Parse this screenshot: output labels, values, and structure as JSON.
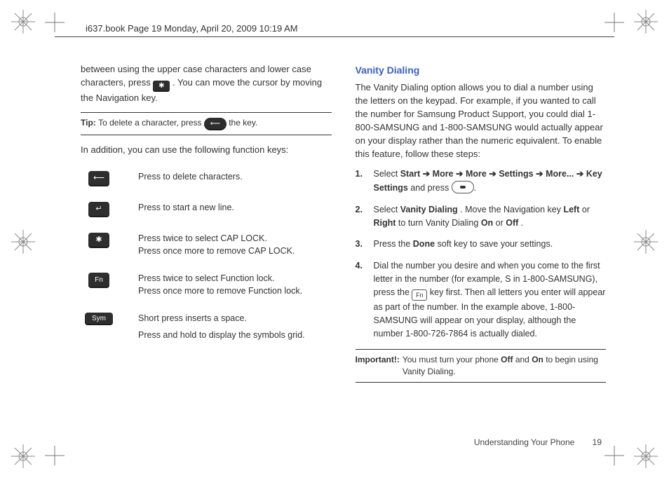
{
  "header": {
    "text": "i637.book  Page 19  Monday, April 20, 2009  10:19 AM"
  },
  "left": {
    "intro_a": "between using the upper case characters and lower case characters, press ",
    "intro_b": ". You can move the cursor by moving the Navigation key.",
    "tip_lead": "Tip: ",
    "tip_a": "To delete a character, press ",
    "tip_b": " the key.",
    "addition": "In addition, you can use the following function keys:",
    "rows": [
      {
        "desc": "Press to delete characters."
      },
      {
        "desc": "Press to start a new line."
      },
      {
        "desc1": "Press twice to select CAP LOCK.",
        "desc2": "Press once more to remove CAP LOCK."
      },
      {
        "desc1": "Press twice to select Function lock.",
        "desc2": "Press once more to remove Function lock."
      },
      {
        "desc1": "Short press inserts a space.",
        "desc2": "Press and hold to display the symbols grid."
      }
    ],
    "sym_label": "Sym",
    "fn_label": "Fn",
    "caps_glyph": "✱",
    "enter_glyph": "↵",
    "back_glyph": "⟵"
  },
  "right": {
    "heading": "Vanity Dialing",
    "intro": "The Vanity Dialing option allows you to dial a number using the letters on the keypad. For example, if you wanted to call the number for Samsung Product Support, you could dial 1-800-SAMSUNG and 1-800-SAMSUNG would actually appear on your display rather than the numeric equivalent. To enable this feature, follow these steps:",
    "arrow": "➔",
    "step1": {
      "pre": "Select ",
      "s1": "Start",
      "s2": "More",
      "s3": "More",
      "s4": "Settings",
      "s5": "More...",
      "s6": "Key Settings",
      "post": " and press "
    },
    "step2": {
      "a": "Select ",
      "b": "Vanity Dialing",
      "c": ". Move the Navigation key ",
      "left": "Left",
      "or": " or ",
      "right": "Right",
      "d": " to turn Vanity Dialing ",
      "on": "On",
      "or2": " or ",
      "off": "Off",
      "e": "."
    },
    "step3": {
      "a": "Press the ",
      "done": "Done",
      "b": " soft key to save your settings."
    },
    "step4": {
      "a": "Dial the number you desire and when you come to the first letter in the number (for example, S in 1-800-SAMSUNG), press the ",
      "b": " key first. Then all letters you enter will appear as part of the number. In the example above, 1-800-SAMSUNG will appear on your display, although the number 1-800-726-7864 is actually dialed."
    },
    "important_lead": "Important!:",
    "important_a": " You must turn your phone ",
    "off": "Off",
    "and": " and ",
    "on": "On",
    "important_b": " to begin using Vanity Dialing."
  },
  "footer": {
    "section": "Understanding Your Phone",
    "page": "19"
  }
}
